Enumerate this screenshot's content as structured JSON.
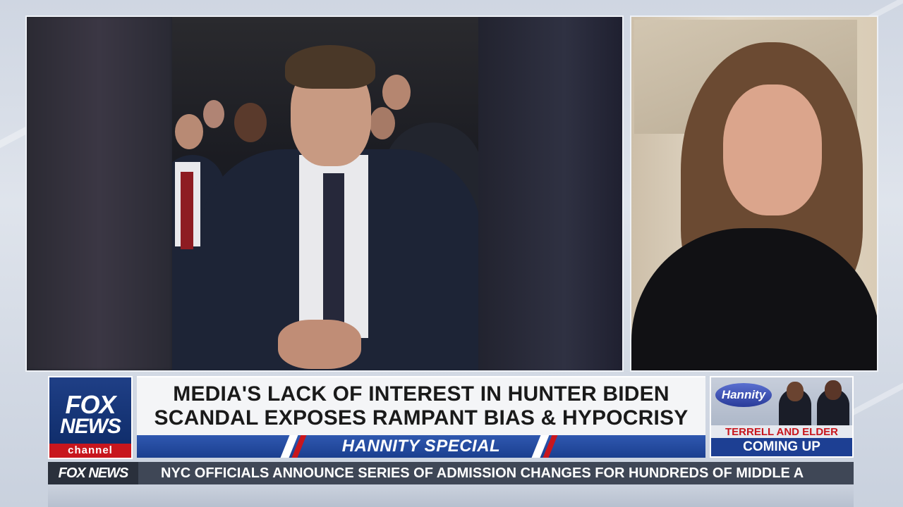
{
  "headline": {
    "line1": "MEDIA'S LACK OF INTEREST IN HUNTER BIDEN",
    "line2": "SCANDAL EXPOSES RAMPANT BIAS & HYPOCRISY"
  },
  "show_bar": {
    "label": "HANNITY SPECIAL"
  },
  "network_logo": {
    "line1": "FOX",
    "line2": "NEWS",
    "channel": "channel"
  },
  "promo": {
    "logo": "Hannity",
    "subtitle": "TERRELL AND ELDER",
    "cta": "COMING UP"
  },
  "ticker": {
    "brand": "FOX NEWS",
    "text": "NYC OFFICIALS ANNOUNCE SERIES OF ADMISSION CHANGES FOR HUNDREDS OF MIDDLE A"
  },
  "colors": {
    "fox_blue": "#1d3f93",
    "fox_red": "#c8161d",
    "headline_bg": "#f4f5f7",
    "ticker_bg": "#3f4756"
  }
}
